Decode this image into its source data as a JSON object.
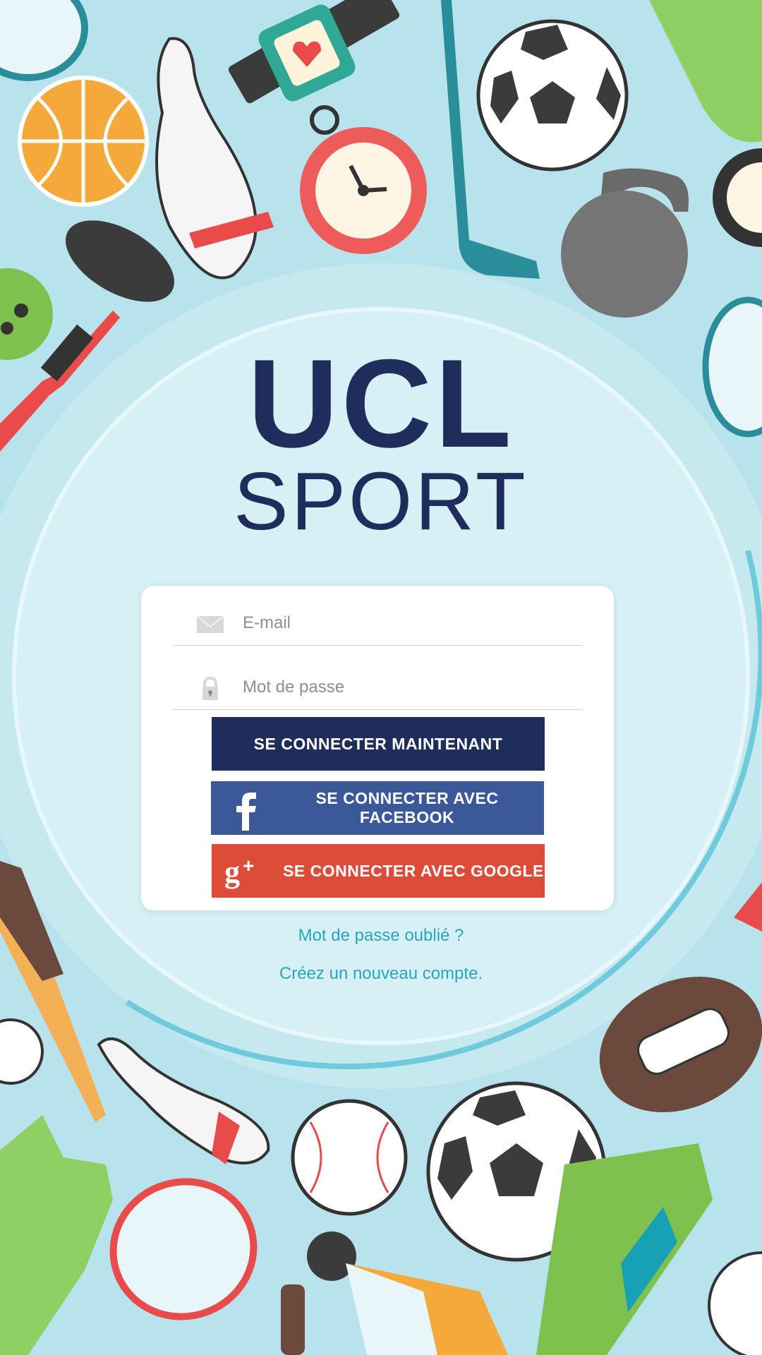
{
  "logo": {
    "line1": "UCL",
    "line2": "SPORT"
  },
  "form": {
    "email": {
      "placeholder": "E-mail",
      "value": ""
    },
    "password": {
      "placeholder": "Mot de passe",
      "value": ""
    }
  },
  "buttons": {
    "login": "SE CONNECTER MAINTENANT",
    "facebook": "SE CONNECTER AVEC FACEBOOK",
    "google": "SE CONNECTER AVEC GOOGLE"
  },
  "links": {
    "forgot_password": "Mot de passe oublié ?",
    "create_account": "Créez un nouveau compte."
  },
  "colors": {
    "brand": "#1f2d5c",
    "facebook": "#3b5998",
    "google": "#dd4b39",
    "link": "#2aa5bf",
    "background": "#b9e3ec"
  },
  "icons": {
    "email": "envelope-icon",
    "password": "lock-icon",
    "facebook": "facebook-icon",
    "google": "google-plus-icon"
  }
}
